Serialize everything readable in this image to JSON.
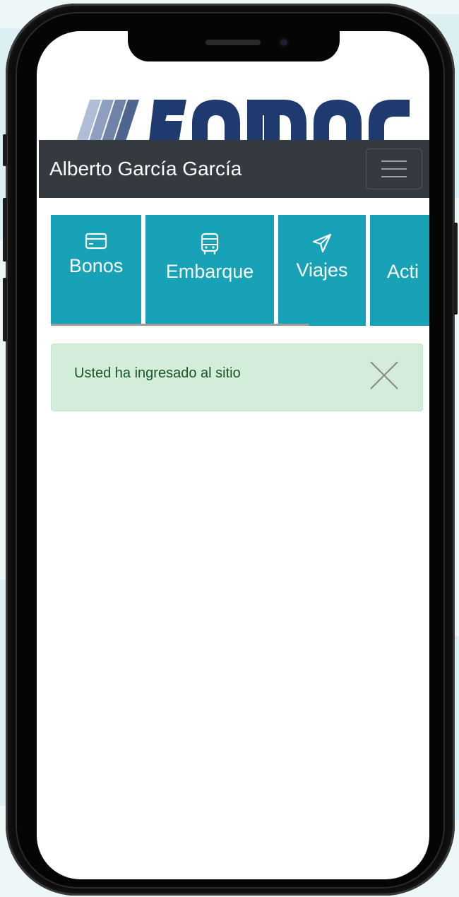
{
  "navbar": {
    "user_name": "Alberto García García",
    "toggler_label": "menu"
  },
  "tiles": [
    {
      "label": "Bonos",
      "icon": "credit-card-icon"
    },
    {
      "label": "Embarque",
      "icon": "bus-icon"
    },
    {
      "label": "Viajes",
      "icon": "send-icon"
    },
    {
      "label": "Acti",
      "icon": "activity-icon"
    }
  ],
  "alert": {
    "message": "Usted ha ingresado al sitio",
    "close_icon": "close-icon"
  },
  "colors": {
    "navbar_bg": "#343a40",
    "tile_bg": "#17a2b8",
    "alert_bg": "#d4edda",
    "alert_text": "#155724",
    "logo_dark": "#1e3a6e",
    "logo_mid": "#6f83a8",
    "logo_light": "#b0bdd6"
  }
}
